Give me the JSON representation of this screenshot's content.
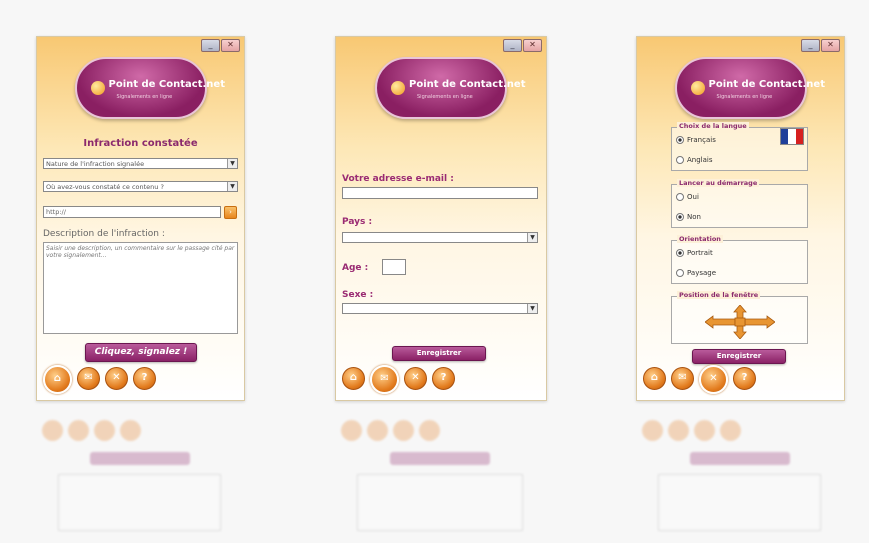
{
  "brand": {
    "name": "Point de Contact.net",
    "tagline": "Signalements en ligne"
  },
  "win1": {
    "heading": "Infraction constatée",
    "select1": "Nature de l'infraction signalée",
    "select2": "Où avez-vous constaté ce contenu ?",
    "url_value": "http://",
    "description_label": "Description de l'infraction :",
    "description_placeholder": "Saisir une description, un commentaire sur le passage cité par votre signalement...",
    "submit_label": "Cliquez, signalez !"
  },
  "win2": {
    "email_label": "Votre adresse e-mail :",
    "country_label": "Pays :",
    "age_label": "Age :",
    "sex_label": "Sexe :",
    "save_label": "Enregistrer"
  },
  "win3": {
    "language_group": "Choix de la langue",
    "lang_fr": "Français",
    "lang_en": "Anglais",
    "startup_group": "Lancer au démarrage",
    "yes": "Oui",
    "no": "Non",
    "orientation_group": "Orientation",
    "portrait": "Portrait",
    "landscape": "Paysage",
    "position_group": "Position de la fenêtre",
    "save_label": "Enregistrer"
  },
  "window_controls": {
    "minimize": "_",
    "close": "✕"
  },
  "nav_icons": [
    "home-icon",
    "mail-icon",
    "tools-icon",
    "help-icon"
  ],
  "colors": {
    "accent": "#8a2166",
    "orange": "#e27a1c"
  }
}
